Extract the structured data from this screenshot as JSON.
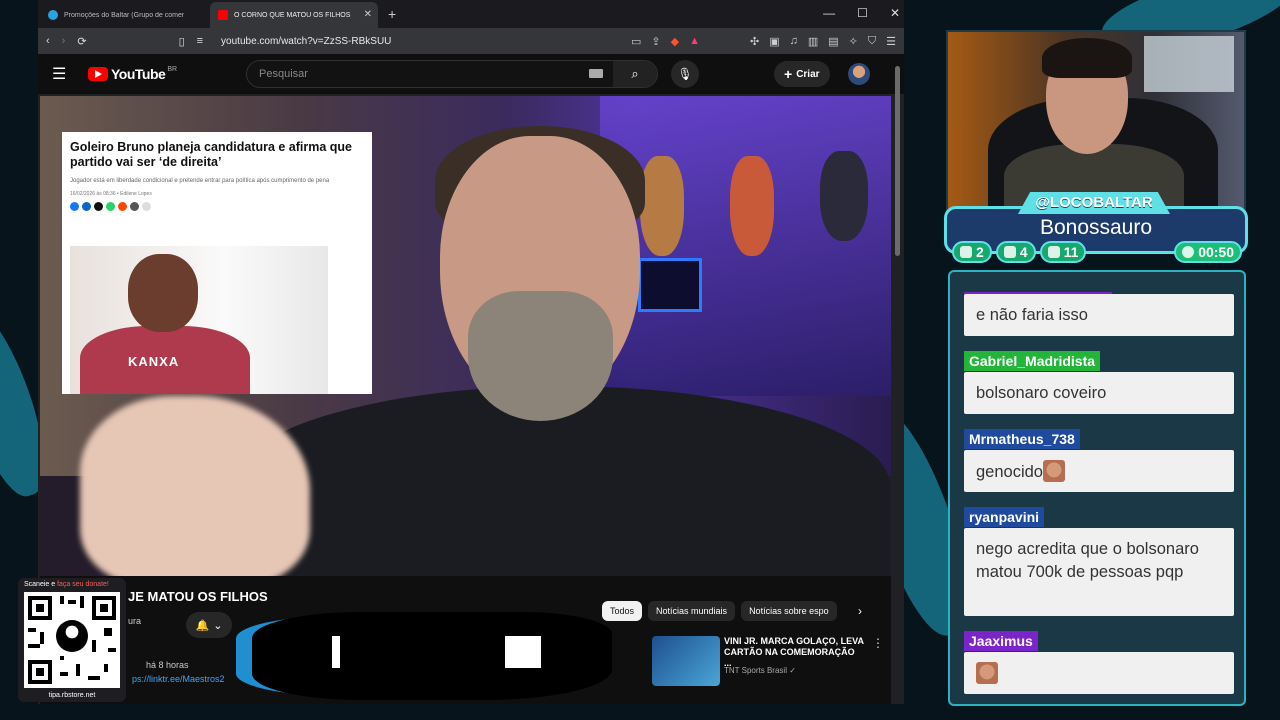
{
  "browser": {
    "tabs": [
      {
        "label": "Promoções do Baltar (Grupo de comentários",
        "active": false
      },
      {
        "label": "O CORNO QUE MATOU OS FILHOS",
        "active": true
      }
    ],
    "url": "youtube.com/watch?v=ZzSS-RBkSUU"
  },
  "youtube": {
    "logo": "YouTube",
    "region": "BR",
    "search_placeholder": "Pesquisar",
    "create_label": "Criar",
    "video_title_fragment": "JE MATOU OS FILHOS",
    "channel_fragment": "ura",
    "meta_fragment": "há 8 horas",
    "link_fragment": "ps://linktr.ee/Maestros2",
    "chips": [
      "Todos",
      "Notícias mundiais",
      "Notícias sobre espo"
    ],
    "recommended": {
      "title": "VINI JR. MARCA GOLAÇO, LEVA CARTÃO NA COMEMORAÇÃO ...",
      "channel": "TNT Sports Brasil"
    }
  },
  "news_card": {
    "headline": "Goleiro Bruno planeja candidatura e afirma que partido vai ser ‘de direita’",
    "subtitle": "Jogador está em liberdade condicional e pretende entrar para política após cumprimento de pena",
    "meta": "16/02/2026 às 08:36 • Edilene Lopes",
    "shirt_text": "KANXA"
  },
  "qr": {
    "caption_prefix": "Scaneie e ",
    "caption_highlight": "faça seu donate!",
    "url": "tipa.rbstore.net"
  },
  "stream": {
    "handle": "@LOCOBALTAR",
    "title": "Bonossauro",
    "stats": {
      "twitch": "2",
      "youtube": "4",
      "kick": "11",
      "uptime": "00:50"
    }
  },
  "chat": [
    {
      "user": "",
      "text": "e não faria isso",
      "color": "#7a24c9"
    },
    {
      "user": "Gabriel_Madridista",
      "text": "bolsonaro coveiro",
      "color": "#22b53a"
    },
    {
      "user": "Mrmatheus_738",
      "text": "genocido",
      "color": "#1f4a9e"
    },
    {
      "user": "ryanpavini",
      "text": "nego acredita que o bolsonaro matou 700k de pessoas pqp",
      "color": "#1f4a9e"
    },
    {
      "user": "Jaaximus",
      "text": "",
      "color": "#7a24c9"
    }
  ],
  "colors": {
    "accent": "#5ee0e6",
    "yt_red": "#ff0000",
    "chat_bg": "#1b3846"
  }
}
